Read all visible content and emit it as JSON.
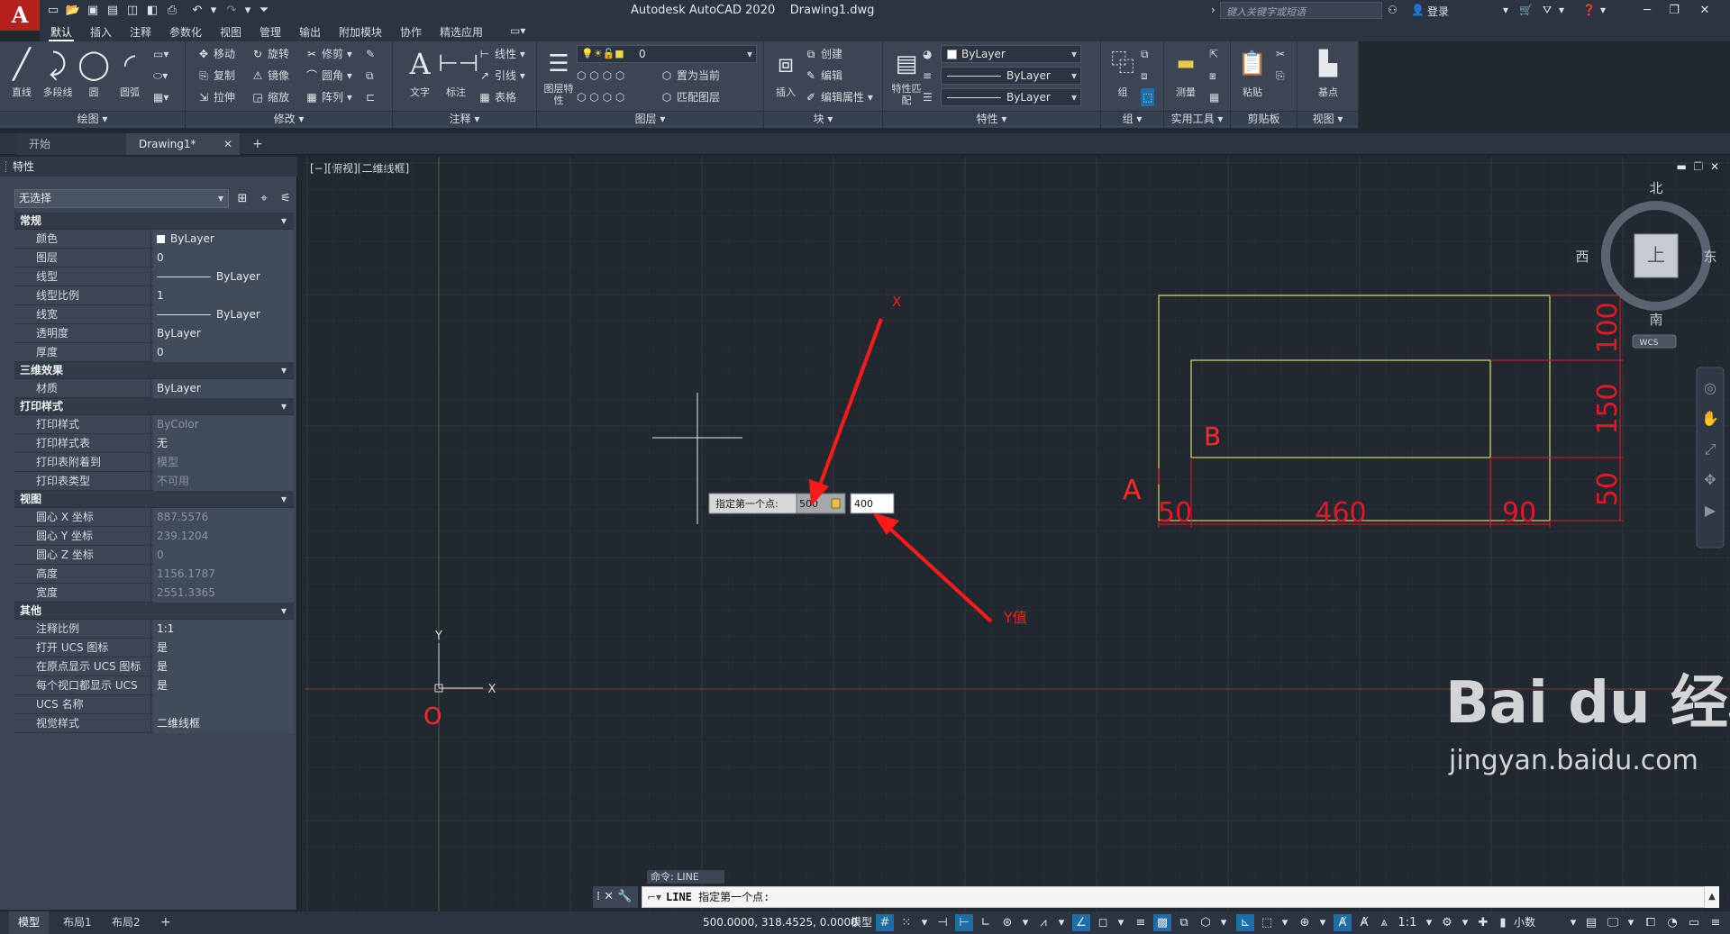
{
  "app": {
    "title": "Autodesk AutoCAD 2020",
    "document": "Drawing1.dwg",
    "logo_letter": "A",
    "search_placeholder": "键入关键字或短语",
    "login": "登录"
  },
  "ribbon_tabs": [
    "默认",
    "插入",
    "注释",
    "参数化",
    "视图",
    "管理",
    "输出",
    "附加模块",
    "协作",
    "精选应用"
  ],
  "ribbon": {
    "draw": {
      "title": "绘图",
      "line": "直线",
      "polyline": "多段线",
      "circle": "圆",
      "arc": "圆弧"
    },
    "modify": {
      "title": "修改",
      "move": "移动",
      "rotate": "旋转",
      "trim": "修剪",
      "copy": "复制",
      "mirror": "镜像",
      "fillet": "圆角",
      "stretch": "拉伸",
      "scale": "缩放",
      "array": "阵列"
    },
    "annotation": {
      "title": "注释",
      "text": "文字",
      "dimension": "标注",
      "linear": "线性",
      "leader": "引线",
      "table": "表格"
    },
    "layers": {
      "title": "图层",
      "layer_props": "图层特性",
      "current_layer": "0",
      "set_current": "置为当前",
      "match_layer": "匹配图层"
    },
    "block": {
      "title": "块",
      "insert": "插入",
      "create": "创建",
      "edit": "编辑",
      "edit_attr": "编辑属性"
    },
    "properties": {
      "title": "特性",
      "match": "特性匹配",
      "color": "ByLayer",
      "linetype": "ByLayer",
      "lineweight": "ByLayer"
    },
    "groups": {
      "title": "组",
      "group": "组"
    },
    "utilities": {
      "title": "实用工具",
      "measure": "测量"
    },
    "clipboard": {
      "title": "剪贴板",
      "paste": "粘贴"
    },
    "view": {
      "title": "视图",
      "base": "基点"
    }
  },
  "doc_tabs": {
    "start": "开始",
    "drawing": "Drawing1*"
  },
  "properties_palette": {
    "title": "特性",
    "selection": "无选择",
    "sections": [
      {
        "name": "常规",
        "rows": [
          {
            "key": "颜色",
            "value": "ByLayer",
            "swatch": true
          },
          {
            "key": "图层",
            "value": "0"
          },
          {
            "key": "线型",
            "value": "ByLayer",
            "line": true
          },
          {
            "key": "线型比例",
            "value": "1"
          },
          {
            "key": "线宽",
            "value": "ByLayer",
            "line": true
          },
          {
            "key": "透明度",
            "value": "ByLayer"
          },
          {
            "key": "厚度",
            "value": "0"
          }
        ]
      },
      {
        "name": "三维效果",
        "rows": [
          {
            "key": "材质",
            "value": "ByLayer"
          }
        ]
      },
      {
        "name": "打印样式",
        "rows": [
          {
            "key": "打印样式",
            "value": "ByColor",
            "dim": true
          },
          {
            "key": "打印样式表",
            "value": "无"
          },
          {
            "key": "打印表附着到",
            "value": "模型",
            "dim": true
          },
          {
            "key": "打印表类型",
            "value": "不可用",
            "dim": true
          }
        ]
      },
      {
        "name": "视图",
        "rows": [
          {
            "key": "圆心 X 坐标",
            "value": "887.5576",
            "dim": true
          },
          {
            "key": "圆心 Y 坐标",
            "value": "239.1204",
            "dim": true
          },
          {
            "key": "圆心 Z 坐标",
            "value": "0",
            "dim": true
          },
          {
            "key": "高度",
            "value": "1156.1787",
            "dim": true
          },
          {
            "key": "宽度",
            "value": "2551.3365",
            "dim": true
          }
        ]
      },
      {
        "name": "其他",
        "rows": [
          {
            "key": "注释比例",
            "value": "1:1"
          },
          {
            "key": "打开 UCS 图标",
            "value": "是"
          },
          {
            "key": "在原点显示 UCS 图标",
            "value": "是"
          },
          {
            "key": "每个视口都显示 UCS",
            "value": "是"
          },
          {
            "key": "UCS 名称",
            "value": ""
          },
          {
            "key": "视觉样式",
            "value": "二维线框"
          }
        ]
      }
    ]
  },
  "viewport": {
    "label": "[−][俯视][二维线框]",
    "viewcube": {
      "north": "北",
      "south": "南",
      "east": "东",
      "west": "西",
      "top": "上",
      "wcs": "WCS"
    },
    "dynamic_input": {
      "prompt": "指定第一个点:",
      "x": "500",
      "y": "400"
    },
    "annotations": {
      "x_label": "X",
      "y_label": "Y值",
      "origin": "O",
      "point_a": "A",
      "rect_b": "B"
    },
    "dimensions": {
      "d50_left": "50",
      "d460": "460",
      "d90": "90",
      "d100": "100",
      "d150": "150",
      "d50_bottom": "50"
    },
    "ucs": {
      "x": "X",
      "y": "Y"
    }
  },
  "command": {
    "history": "命令: LINE",
    "prompt_cmd": "LINE",
    "prompt_text": "指定第一个点:"
  },
  "statusbar": {
    "model_tab": "模型",
    "layout1": "布局1",
    "layout2": "布局2",
    "coords": "500.0000, 318.4525, 0.0000",
    "model": "模型",
    "scale": "1:1",
    "units": "小数"
  },
  "watermark": {
    "brand": "Bai du 经验",
    "url": "jingyan.baidu.com"
  },
  "colors": {
    "accent_red": "#ff1a1a",
    "rect_yellow": "#d9d96a",
    "dim_red": "#e0182a",
    "canvas": "#212830",
    "panel": "#3b4553"
  }
}
